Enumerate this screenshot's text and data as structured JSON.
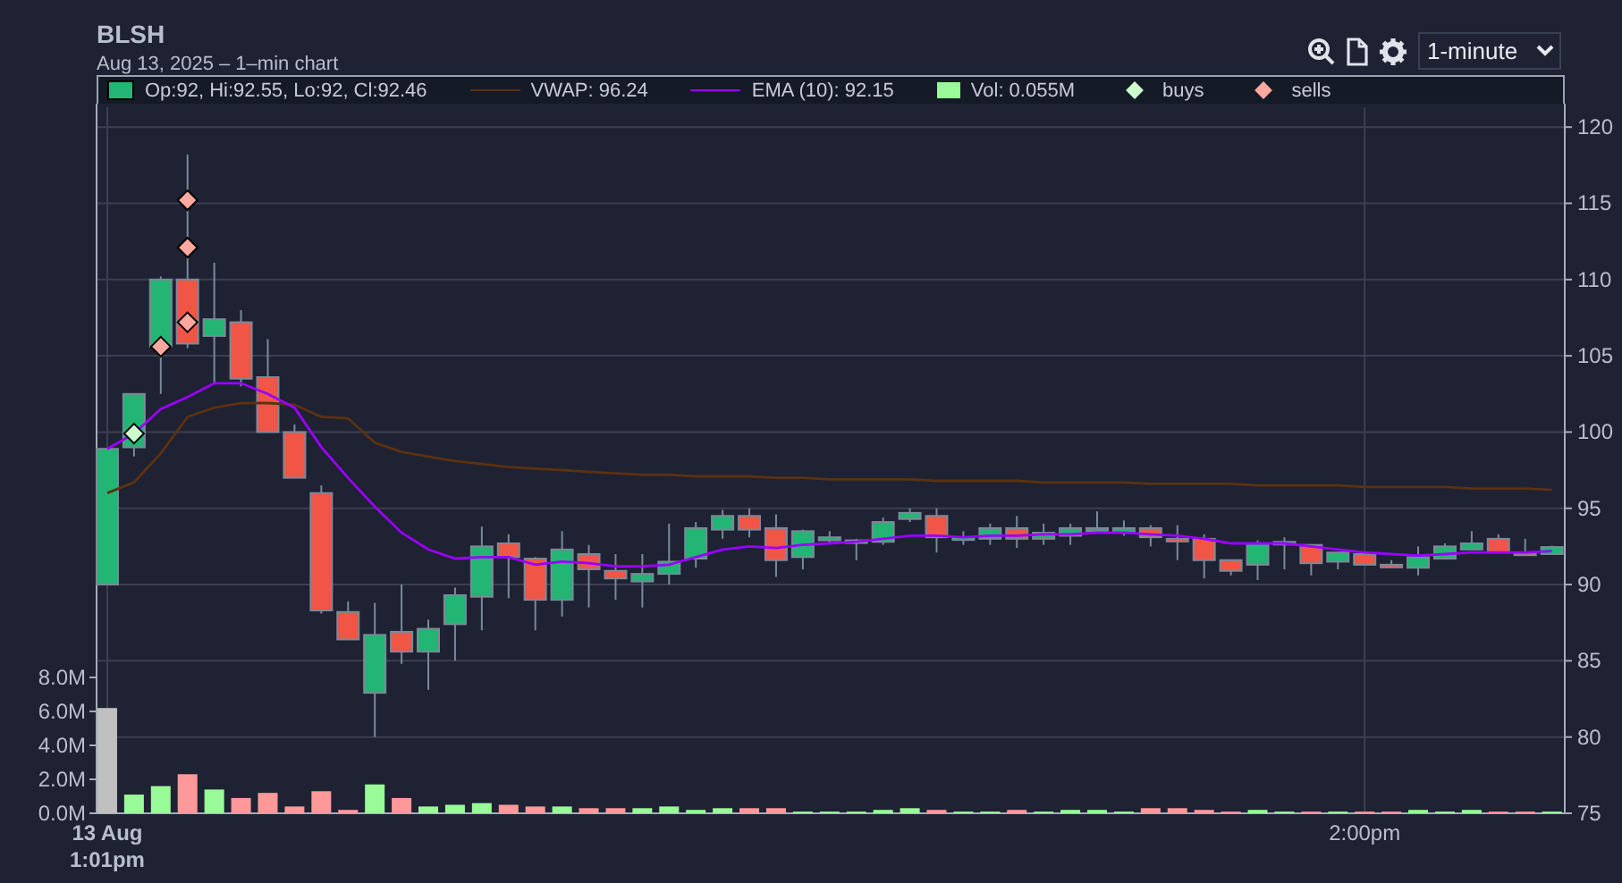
{
  "header": {
    "symbol": "BLSH",
    "subtitle": "Aug 13, 2025 – 1–min chart"
  },
  "toolbar": {
    "interval": "1-minute"
  },
  "price_chart": {
    "ohlc_legend": "Op:92, Hi:92.55, Lo:92, Cl:92.46",
    "chart_data": {
      "type": "candlestick",
      "grid": true,
      "categories": [
        null,
        null,
        null,
        null,
        null,
        null,
        null,
        null,
        null,
        null,
        null,
        null,
        null,
        null,
        null,
        null,
        null,
        null,
        null,
        null,
        null,
        null,
        null,
        null,
        null,
        null,
        null,
        null,
        null,
        null,
        null,
        null,
        null,
        null,
        null,
        null,
        null,
        null,
        null,
        null,
        null,
        null,
        null,
        null,
        null,
        null,
        null,
        null,
        null,
        null,
        null,
        null,
        null,
        null,
        null
      ],
      "ylim": [
        75,
        121.3
      ],
      "yticks": [
        75,
        80,
        85,
        90,
        95,
        100,
        105,
        110,
        115,
        120
      ],
      "ohlc": [
        [
          90,
          98.9,
          90,
          98.9
        ],
        [
          99,
          102.5,
          98.4,
          102.5
        ],
        [
          105.6,
          110.2,
          102.5,
          110
        ],
        [
          110,
          118.2,
          105.5,
          105.8
        ],
        [
          106.3,
          111.1,
          103.2,
          107.4
        ],
        [
          107.2,
          108,
          103,
          103.5
        ],
        [
          103.6,
          106.1,
          100,
          100
        ],
        [
          100,
          100.5,
          97,
          97
        ],
        [
          96,
          96.5,
          88.1,
          88.3
        ],
        [
          88.2,
          88.9,
          86.4,
          86.4
        ],
        [
          82.9,
          88.8,
          80,
          86.7
        ],
        [
          86.9,
          90,
          84.8,
          85.6
        ],
        [
          85.6,
          87.7,
          83.1,
          87.1
        ],
        [
          87.4,
          89.8,
          85,
          89.3
        ],
        [
          89.2,
          93.8,
          87,
          92.5
        ],
        [
          92.7,
          93.3,
          89.1,
          91.8
        ],
        [
          91.7,
          91.8,
          87,
          89
        ],
        [
          89,
          93.5,
          87.9,
          92.3
        ],
        [
          92,
          92.6,
          88.5,
          91
        ],
        [
          90.9,
          92,
          89,
          90.4
        ],
        [
          90.2,
          92,
          88.5,
          90.7
        ],
        [
          90.7,
          94,
          90,
          91.5
        ],
        [
          91.7,
          94.1,
          91.1,
          93.7
        ],
        [
          93.6,
          94.9,
          93,
          94.5
        ],
        [
          94.5,
          95,
          93.1,
          93.6
        ],
        [
          93.7,
          94.6,
          90.5,
          91.6
        ],
        [
          91.8,
          93.6,
          91,
          93.5
        ],
        [
          92.9,
          93.5,
          92.7,
          93.1
        ],
        [
          92.8,
          93,
          91.6,
          92.9
        ],
        [
          92.8,
          94.4,
          92.6,
          94.1
        ],
        [
          94.3,
          95,
          94.1,
          94.7
        ],
        [
          94.5,
          95,
          92.1,
          93.1
        ],
        [
          93,
          93.5,
          92.6,
          93.1
        ],
        [
          93,
          94,
          92.6,
          93.7
        ],
        [
          93.7,
          94.5,
          92.4,
          93
        ],
        [
          93,
          94,
          92.6,
          93.4
        ],
        [
          93.2,
          94,
          92.6,
          93.7
        ],
        [
          93.5,
          94.8,
          93.4,
          93.7
        ],
        [
          93.4,
          94.2,
          93.2,
          93.7
        ],
        [
          93.7,
          93.9,
          92.5,
          93.1
        ],
        [
          93,
          93.9,
          91.6,
          92.9
        ],
        [
          93,
          93.3,
          90.4,
          91.6
        ],
        [
          91.6,
          91.6,
          90.6,
          90.9
        ],
        [
          91.3,
          92.9,
          90.3,
          92.7
        ],
        [
          92.7,
          93.1,
          91,
          92.8
        ],
        [
          92.6,
          92.6,
          90.6,
          91.4
        ],
        [
          91.5,
          92.1,
          91,
          92.1
        ],
        [
          92,
          92,
          91.3,
          91.3
        ],
        [
          91.3,
          91.6,
          91.2,
          91.2
        ],
        [
          91.1,
          92.5,
          90.6,
          91.8
        ],
        [
          91.7,
          92.7,
          91.7,
          92.5
        ],
        [
          92.3,
          93.5,
          92.3,
          92.7
        ],
        [
          93,
          93.3,
          92.1,
          92.1
        ],
        [
          92.1,
          93,
          92,
          92
        ],
        [
          92,
          92.55,
          92,
          92.46
        ]
      ],
      "series": [
        {
          "name": "VWAP: 96.24",
          "type": "line",
          "color": "#5c3210",
          "values": [
            96.0,
            96.7,
            98.6,
            101.0,
            101.6,
            101.9,
            101.9,
            101.8,
            101.0,
            100.9,
            99.3,
            98.7,
            98.4,
            98.1,
            97.9,
            97.7,
            97.6,
            97.5,
            97.4,
            97.3,
            97.2,
            97.2,
            97.1,
            97.1,
            97.1,
            97.0,
            97.0,
            96.9,
            96.9,
            96.9,
            96.9,
            96.8,
            96.8,
            96.8,
            96.8,
            96.7,
            96.7,
            96.7,
            96.7,
            96.6,
            96.6,
            96.6,
            96.6,
            96.5,
            96.5,
            96.5,
            96.5,
            96.4,
            96.4,
            96.4,
            96.4,
            96.3,
            96.3,
            96.3,
            96.2
          ]
        },
        {
          "name": "EMA (10): 92.15",
          "type": "line",
          "color": "#9b00ff",
          "values": [
            98.9,
            99.9,
            101.5,
            102.3,
            103.2,
            103.2,
            102.5,
            101.6,
            99.0,
            97.0,
            95.1,
            93.4,
            92.3,
            91.7,
            91.8,
            91.8,
            91.3,
            91.5,
            91.4,
            91.2,
            91.2,
            91.3,
            91.8,
            92.3,
            92.5,
            92.4,
            92.6,
            92.7,
            92.8,
            93.0,
            93.2,
            93.2,
            93.1,
            93.2,
            93.2,
            93.3,
            93.3,
            93.4,
            93.4,
            93.3,
            93.2,
            93.0,
            92.7,
            92.7,
            92.7,
            92.5,
            92.3,
            92.1,
            92.0,
            91.9,
            92.0,
            92.1,
            92.1,
            92.1,
            92.2
          ]
        },
        {
          "name": "buys",
          "type": "scatter",
          "color": "#ccffcc",
          "values": [
            null,
            99.9,
            null,
            null,
            null,
            null,
            null,
            null,
            null,
            null,
            null,
            null,
            null,
            null,
            null,
            null,
            null,
            null,
            null,
            null,
            null,
            null,
            null,
            null,
            null,
            null,
            null,
            null,
            null,
            null,
            null,
            null,
            null,
            null,
            null,
            null,
            null,
            null,
            null,
            null,
            null,
            null,
            null,
            null,
            null,
            null,
            null,
            null,
            null,
            null,
            null,
            null,
            null,
            null,
            null
          ]
        },
        {
          "name": "sells",
          "type": "scatter",
          "color": "#ffa8a0",
          "values": [
            null,
            null,
            105.6,
            115.2,
            null,
            null,
            null,
            null,
            null,
            null,
            null,
            null,
            null,
            null,
            null,
            null,
            null,
            null,
            null,
            null,
            null,
            null,
            null,
            null,
            null,
            null,
            null,
            null,
            null,
            null,
            null,
            null,
            null,
            null,
            null,
            null,
            null,
            null,
            null,
            null,
            null,
            null,
            null,
            null,
            null,
            null,
            null,
            null,
            null,
            null,
            null,
            null,
            null,
            null,
            null
          ]
        },
        {
          "name": null,
          "type": "scatter",
          "color": "#ffa8a0",
          "values": [
            null,
            null,
            null,
            112.1,
            null,
            null,
            null,
            null,
            null,
            null,
            null,
            null,
            null,
            null,
            null,
            null,
            null,
            null,
            null,
            null,
            null,
            null,
            null,
            null,
            null,
            null,
            null,
            null,
            null,
            null,
            null,
            null,
            null,
            null,
            null,
            null,
            null,
            null,
            null,
            null,
            null,
            null,
            null,
            null,
            null,
            null,
            null,
            null,
            null,
            null,
            null,
            null,
            null,
            null,
            null
          ]
        },
        {
          "name": null,
          "type": "scatter",
          "color": "#ffa8a0",
          "values": [
            null,
            null,
            null,
            107.2,
            null,
            null,
            null,
            null,
            null,
            null,
            null,
            null,
            null,
            null,
            null,
            null,
            null,
            null,
            null,
            null,
            null,
            null,
            null,
            null,
            null,
            null,
            null,
            null,
            null,
            null,
            null,
            null,
            null,
            null,
            null,
            null,
            null,
            null,
            null,
            null,
            null,
            null,
            null,
            null,
            null,
            null,
            null,
            null,
            null,
            null,
            null,
            null,
            null,
            null,
            null
          ]
        }
      ]
    }
  },
  "volume_chart": {
    "chart_data": {
      "type": "bar",
      "categories": [
        "13 Aug 1:01pm",
        null,
        null,
        null,
        null,
        null,
        null,
        null,
        null,
        null,
        null,
        null,
        null,
        null,
        null,
        null,
        null,
        null,
        null,
        null,
        null,
        null,
        null,
        null,
        null,
        null,
        null,
        null,
        null,
        null,
        null,
        null,
        null,
        null,
        null,
        null,
        null,
        null,
        null,
        null,
        null,
        null,
        null,
        null,
        null,
        null,
        null,
        "2:00pm",
        null,
        null,
        null,
        null,
        null,
        null,
        null
      ],
      "ylim": [
        0,
        8
      ],
      "yticks": [
        {
          "value": 0,
          "label": "0.0M"
        },
        {
          "value": 2,
          "label": "2.0M"
        },
        {
          "value": 4,
          "label": "4.0M"
        },
        {
          "value": 6,
          "label": "6.0M"
        },
        {
          "value": 8,
          "label": "8.0M"
        }
      ],
      "series": [
        {
          "name": "Vol: 0.055M",
          "color": "#98fb98",
          "values": [
            null,
            1.1,
            1.6,
            null,
            1.4,
            null,
            null,
            null,
            null,
            null,
            1.7,
            null,
            0.4,
            0.5,
            0.6,
            null,
            null,
            0.4,
            null,
            null,
            0.3,
            0.4,
            0.2,
            0.3,
            null,
            null,
            0.1,
            0.1,
            0.1,
            0.2,
            0.3,
            null,
            0.1,
            0.1,
            null,
            0.1,
            0.2,
            0.2,
            0.1,
            null,
            null,
            null,
            null,
            0.2,
            0.1,
            null,
            0.1,
            null,
            null,
            0.2,
            0.1,
            0.2,
            null,
            null,
            0.1
          ]
        },
        {
          "name": null,
          "color": "#ff9999",
          "values": [
            null,
            null,
            null,
            2.3,
            null,
            0.9,
            1.2,
            0.4,
            1.3,
            0.2,
            null,
            0.9,
            null,
            null,
            null,
            0.5,
            0.4,
            null,
            0.3,
            0.3,
            null,
            null,
            null,
            null,
            0.3,
            0.3,
            null,
            null,
            null,
            null,
            null,
            0.2,
            null,
            null,
            0.2,
            null,
            null,
            null,
            null,
            0.3,
            0.3,
            0.2,
            0.1,
            null,
            null,
            0.1,
            null,
            0.1,
            0.1,
            null,
            null,
            null,
            0.1,
            0.1,
            null
          ]
        },
        {
          "name": null,
          "color": "#c0c0c0",
          "values": [
            6.2,
            null,
            null,
            null,
            null,
            null,
            null,
            null,
            null,
            null,
            null,
            null,
            null,
            null,
            null,
            null,
            null,
            null,
            null,
            null,
            null,
            null,
            null,
            null,
            null,
            null,
            null,
            null,
            null,
            null,
            null,
            null,
            null,
            null,
            null,
            null,
            null,
            null,
            null,
            null,
            null,
            null,
            null,
            null,
            null,
            null,
            null,
            null,
            null,
            null,
            null,
            null,
            null,
            null,
            null
          ]
        }
      ]
    }
  }
}
